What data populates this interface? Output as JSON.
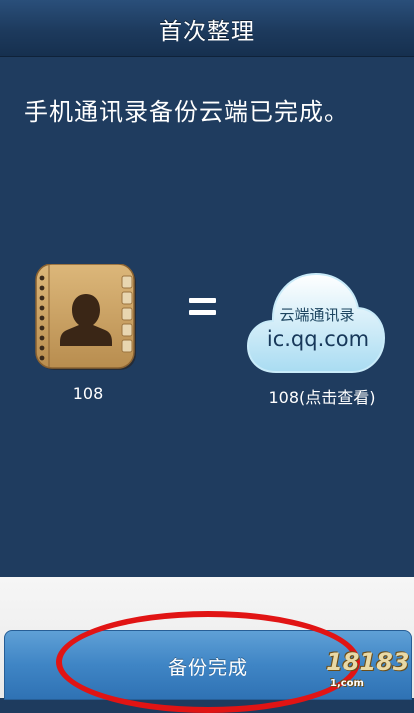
{
  "header": {
    "title": "首次整理"
  },
  "main": {
    "message": "手机通讯录备份云端已完成。",
    "local": {
      "icon": "contacts-book-icon",
      "count": "108"
    },
    "equals_icon": "equals-sign-icon",
    "cloud": {
      "icon": "cloud-icon",
      "label": "云端通讯录",
      "domain": "ic.qq.com",
      "count_text": "108(点击查看)"
    }
  },
  "footer": {
    "done_button_label": "备份完成"
  },
  "annotation": {
    "ellipse_color": "#e11414"
  },
  "watermark": {
    "text": "18183",
    "sub": "1,com"
  },
  "colors": {
    "background": "#1f3c5f",
    "button": "#3f85c5"
  }
}
